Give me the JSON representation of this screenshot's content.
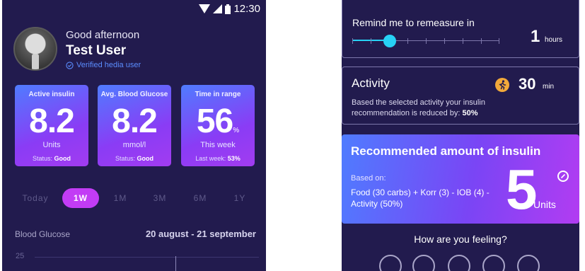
{
  "status_bar": {
    "time": "12:30"
  },
  "greeting": {
    "salutation": "Good afternoon",
    "user_name": "Test User",
    "verified_label": "Verified hedia user"
  },
  "stats": [
    {
      "title": "Active insulin",
      "value": "8.2",
      "unit": "Units",
      "status_label": "Status:",
      "status_value": "Good"
    },
    {
      "title": "Avg. Blood Glucose",
      "value": "8.2",
      "unit": "mmol/l",
      "status_label": "Status:",
      "status_value": "Good"
    },
    {
      "title": "Time in range",
      "value": "56",
      "value_suffix": "%",
      "unit": "This week",
      "status_label": "Last week:",
      "status_value": "53%"
    }
  ],
  "time_filters": [
    "Today",
    "1W",
    "1M",
    "3M",
    "6M",
    "1Y"
  ],
  "active_filter": "1W",
  "blood_glucose": {
    "label": "Blood Glucose",
    "date_range": "20 august - 21 september",
    "y_tick_top": "25"
  },
  "remind": {
    "title": "Remind me to remeasure in",
    "value": "1",
    "unit": "hours",
    "slider_value": 1,
    "slider_max": 8
  },
  "activity": {
    "title": "Activity",
    "value": "30",
    "unit": "min",
    "description": "Based the selected activity your insulin recommendation is reduced by:",
    "reduction": "50%"
  },
  "recommendation": {
    "title": "Recommended amount of insulin",
    "based_on_label": "Based on:",
    "detail": "Food (30 carbs) + Korr (3) - IOB (4) - Activity (50%)",
    "value": "5",
    "unit": "Units"
  },
  "feeling": {
    "question": "How are you feeling?"
  },
  "colors": {
    "background": "#221b4e",
    "accent": "#c23cf5",
    "slider": "#27d1f5",
    "verified": "#5b8dff",
    "activity_icon": "#f2a93a"
  }
}
